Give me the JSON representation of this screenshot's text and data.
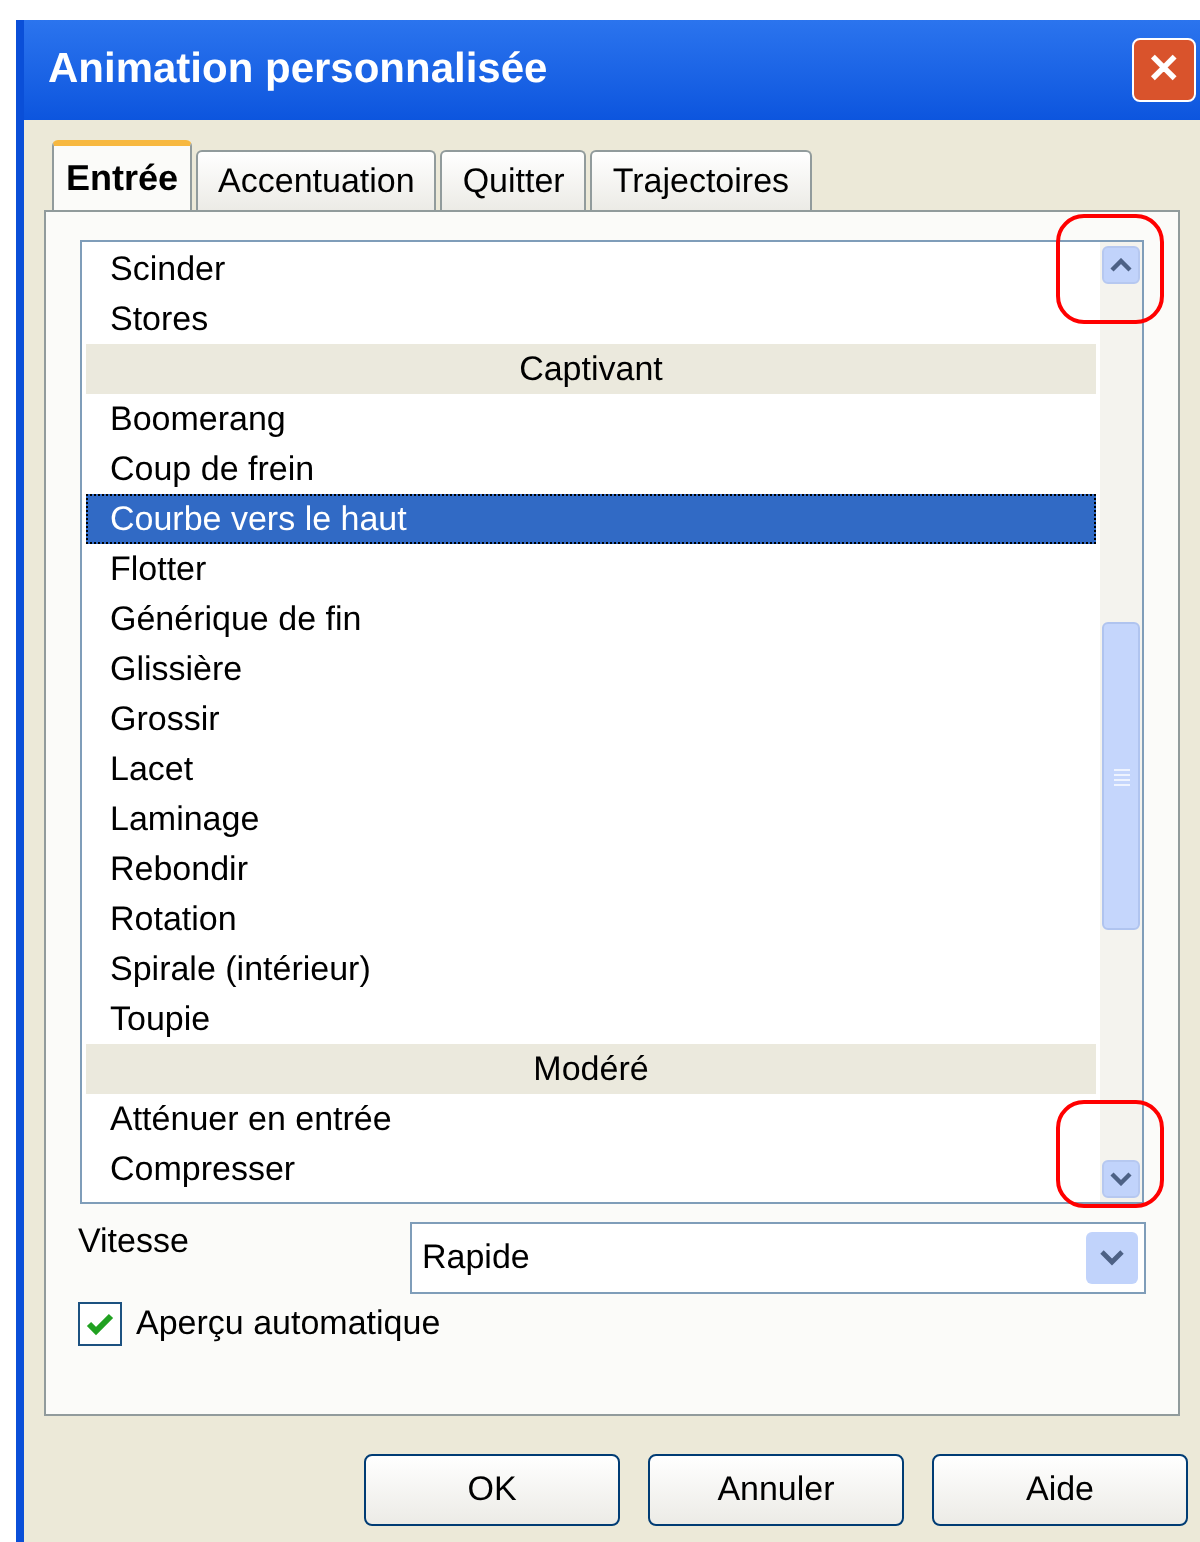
{
  "window": {
    "title": "Animation personnalisée",
    "close": "✕"
  },
  "tabs": [
    {
      "label": "Entrée",
      "selected": true
    },
    {
      "label": "Accentuation",
      "selected": false
    },
    {
      "label": "Quitter",
      "selected": false
    },
    {
      "label": "Trajectoires",
      "selected": false
    }
  ],
  "effects": [
    {
      "kind": "item",
      "label": "Scinder",
      "selected": false
    },
    {
      "kind": "item",
      "label": "Stores",
      "selected": false
    },
    {
      "kind": "header",
      "label": "Captivant"
    },
    {
      "kind": "item",
      "label": "Boomerang",
      "selected": false
    },
    {
      "kind": "item",
      "label": "Coup de frein",
      "selected": false
    },
    {
      "kind": "item",
      "label": "Courbe vers le haut",
      "selected": true
    },
    {
      "kind": "item",
      "label": "Flotter",
      "selected": false
    },
    {
      "kind": "item",
      "label": "Générique de fin",
      "selected": false
    },
    {
      "kind": "item",
      "label": "Glissière",
      "selected": false
    },
    {
      "kind": "item",
      "label": "Grossir",
      "selected": false
    },
    {
      "kind": "item",
      "label": "Lacet",
      "selected": false
    },
    {
      "kind": "item",
      "label": "Laminage",
      "selected": false
    },
    {
      "kind": "item",
      "label": "Rebondir",
      "selected": false
    },
    {
      "kind": "item",
      "label": "Rotation",
      "selected": false
    },
    {
      "kind": "item",
      "label": "Spirale (intérieur)",
      "selected": false
    },
    {
      "kind": "item",
      "label": "Toupie",
      "selected": false
    },
    {
      "kind": "header",
      "label": "Modéré"
    },
    {
      "kind": "item",
      "label": "Atténuer en entrée",
      "selected": false
    },
    {
      "kind": "item",
      "label": "Compresser",
      "selected": false
    }
  ],
  "speed": {
    "label": "Vitesse",
    "value": "Rapide"
  },
  "auto_preview": {
    "label": "Aperçu automatique",
    "checked": true
  },
  "buttons": [
    "OK",
    "Annuler",
    "Aide"
  ]
}
